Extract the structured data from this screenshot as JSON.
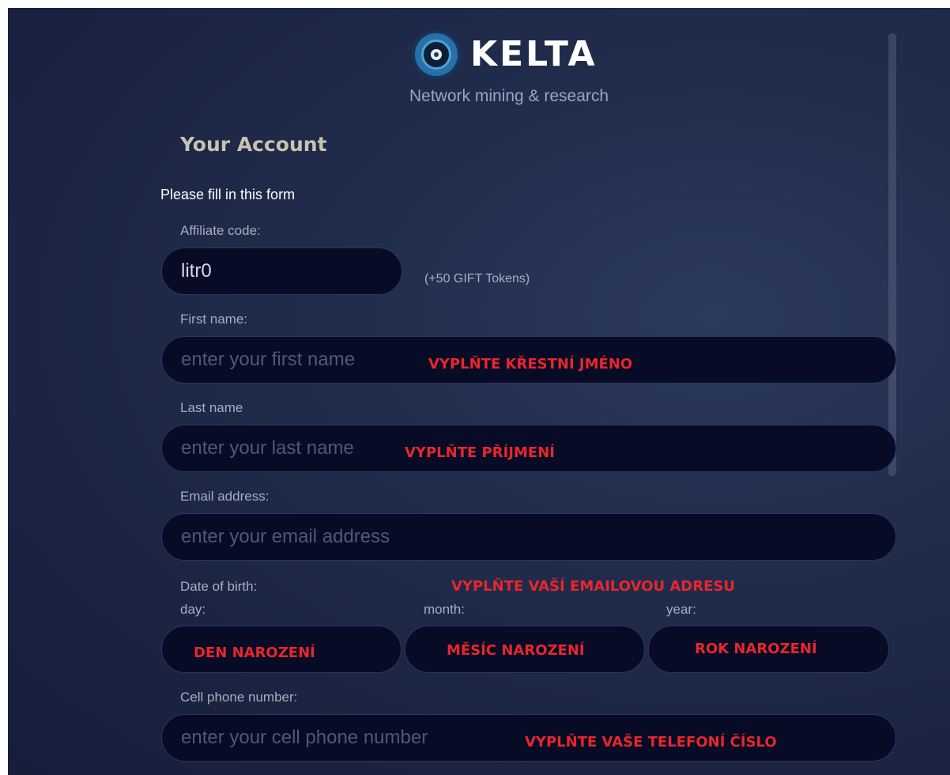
{
  "brand": {
    "name": "KELTA",
    "tagline": "Network mining & research",
    "logo_icon": "kelta-logo-icon"
  },
  "form": {
    "title": "Your Account",
    "subtitle": "Please fill in this form",
    "affiliate": {
      "label": "Affiliate code:",
      "value": "litr0",
      "bonus": "(+50 GIFT Tokens)"
    },
    "first_name": {
      "label": "First name:",
      "placeholder": "enter your first name"
    },
    "last_name": {
      "label": "Last name",
      "placeholder": "enter your last name"
    },
    "email": {
      "label": "Email address:",
      "placeholder": "enter your email address"
    },
    "dob": {
      "label": "Date of birth:",
      "day_label": "day:",
      "month_label": "month:",
      "year_label": "year:"
    },
    "phone": {
      "label": "Cell phone number:",
      "placeholder": "enter your cell phone number"
    }
  },
  "annotations": {
    "first_name": "VYPLŇTE KŘESTNÍ JMÉNO",
    "last_name": "VYPLŇTE PŘÍJMENÍ",
    "email": "VYPLŇTE VAŠÍ EMAILOVOU ADRESU",
    "day": "DEN NAROZENÍ",
    "month": "MĚSÍC NAROZENÍ",
    "year": "ROK NAROZENÍ",
    "phone": "VYPLŇTE VAŠE TELEFONÍ ČÍSLO"
  },
  "colors": {
    "background": "#1f2947",
    "field_bg": "#070b26",
    "annotation": "#e8262c",
    "title": "#c8c3b0"
  }
}
